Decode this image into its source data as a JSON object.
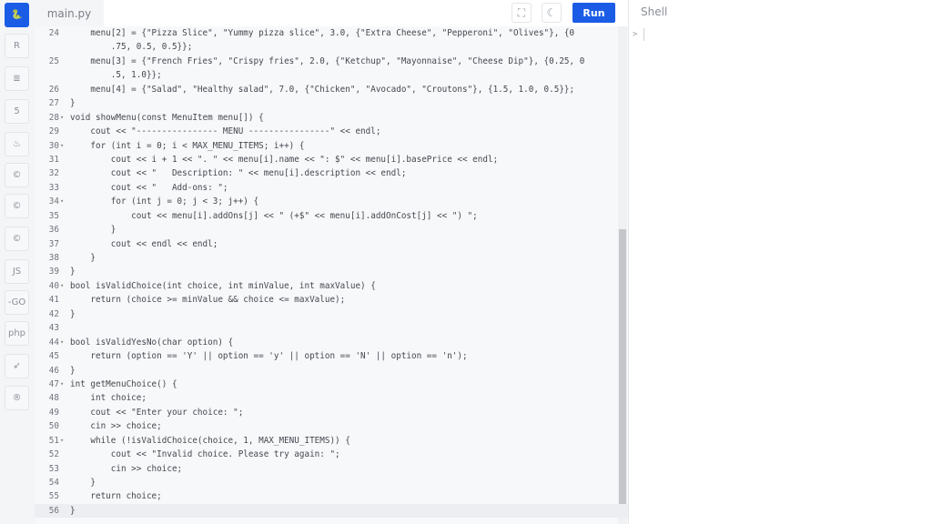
{
  "sidebar": {
    "items": [
      {
        "icon": "python-icon",
        "glyph": "🐍",
        "active": true
      },
      {
        "icon": "r-icon",
        "glyph": "R"
      },
      {
        "icon": "database-icon",
        "glyph": "≣"
      },
      {
        "icon": "html5-icon",
        "glyph": "5"
      },
      {
        "icon": "java-icon",
        "glyph": "♨"
      },
      {
        "icon": "c-icon",
        "glyph": "©"
      },
      {
        "icon": "cpp-icon",
        "glyph": "©"
      },
      {
        "icon": "csharp-icon",
        "glyph": "©"
      },
      {
        "icon": "javascript-icon",
        "glyph": "JS"
      },
      {
        "icon": "go-icon",
        "glyph": "-GO"
      },
      {
        "icon": "php-icon",
        "glyph": "php"
      },
      {
        "icon": "swift-icon",
        "glyph": "➶"
      },
      {
        "icon": "rust-icon",
        "glyph": "®"
      }
    ]
  },
  "editor": {
    "tab_label": "main.py",
    "run_label": "Run",
    "fullscreen_icon": "fullscreen-icon",
    "theme_icon": "moon-icon"
  },
  "shell": {
    "title": "Shell",
    "prompt": ">"
  },
  "code": [
    {
      "n": "24",
      "fold": false,
      "t": "    menu[2] = {\"Pizza Slice\", \"Yummy pizza slice\", 3.0, {\"Extra Cheese\", \"Pepperoni\", \"Olives\"}, {0",
      "w": "        .75, 0.5, 0.5}};"
    },
    {
      "n": "25",
      "fold": false,
      "t": "    menu[3] = {\"French Fries\", \"Crispy fries\", 2.0, {\"Ketchup\", \"Mayonnaise\", \"Cheese Dip\"}, {0.25, 0",
      "w": "        .5, 1.0}};"
    },
    {
      "n": "26",
      "t": "    menu[4] = {\"Salad\", \"Healthy salad\", 7.0, {\"Chicken\", \"Avocado\", \"Croutons\"}, {1.5, 1.0, 0.5}};"
    },
    {
      "n": "27",
      "t": "}"
    },
    {
      "n": "28",
      "fold": true,
      "t": "void showMenu(const MenuItem menu[]) {"
    },
    {
      "n": "29",
      "t": "    cout << \"---------------- MENU ----------------\" << endl;"
    },
    {
      "n": "30",
      "fold": true,
      "t": "    for (int i = 0; i < MAX_MENU_ITEMS; i++) {"
    },
    {
      "n": "31",
      "t": "        cout << i + 1 << \". \" << menu[i].name << \": $\" << menu[i].basePrice << endl;"
    },
    {
      "n": "32",
      "t": "        cout << \"   Description: \" << menu[i].description << endl;"
    },
    {
      "n": "33",
      "t": "        cout << \"   Add-ons: \";"
    },
    {
      "n": "34",
      "fold": true,
      "t": "        for (int j = 0; j < 3; j++) {"
    },
    {
      "n": "35",
      "t": "            cout << menu[i].addOns[j] << \" (+$\" << menu[i].addOnCost[j] << \") \";"
    },
    {
      "n": "36",
      "t": "        }"
    },
    {
      "n": "37",
      "t": "        cout << endl << endl;"
    },
    {
      "n": "38",
      "t": "    }"
    },
    {
      "n": "39",
      "t": "}"
    },
    {
      "n": "40",
      "fold": true,
      "t": "bool isValidChoice(int choice, int minValue, int maxValue) {"
    },
    {
      "n": "41",
      "t": "    return (choice >= minValue && choice <= maxValue);"
    },
    {
      "n": "42",
      "t": "}"
    },
    {
      "n": "43",
      "t": ""
    },
    {
      "n": "44",
      "fold": true,
      "t": "bool isValidYesNo(char option) {"
    },
    {
      "n": "45",
      "t": "    return (option == 'Y' || option == 'y' || option == 'N' || option == 'n');"
    },
    {
      "n": "46",
      "t": "}"
    },
    {
      "n": "47",
      "fold": true,
      "t": "int getMenuChoice() {"
    },
    {
      "n": "48",
      "t": "    int choice;"
    },
    {
      "n": "49",
      "t": "    cout << \"Enter your choice: \";"
    },
    {
      "n": "50",
      "t": "    cin >> choice;"
    },
    {
      "n": "51",
      "fold": true,
      "t": "    while (!isValidChoice(choice, 1, MAX_MENU_ITEMS)) {"
    },
    {
      "n": "52",
      "t": "        cout << \"Invalid choice. Please try again: \";"
    },
    {
      "n": "53",
      "t": "        cin >> choice;"
    },
    {
      "n": "54",
      "t": "    }"
    },
    {
      "n": "55",
      "t": "    return choice;"
    },
    {
      "n": "56",
      "t": "}",
      "current": true
    }
  ]
}
